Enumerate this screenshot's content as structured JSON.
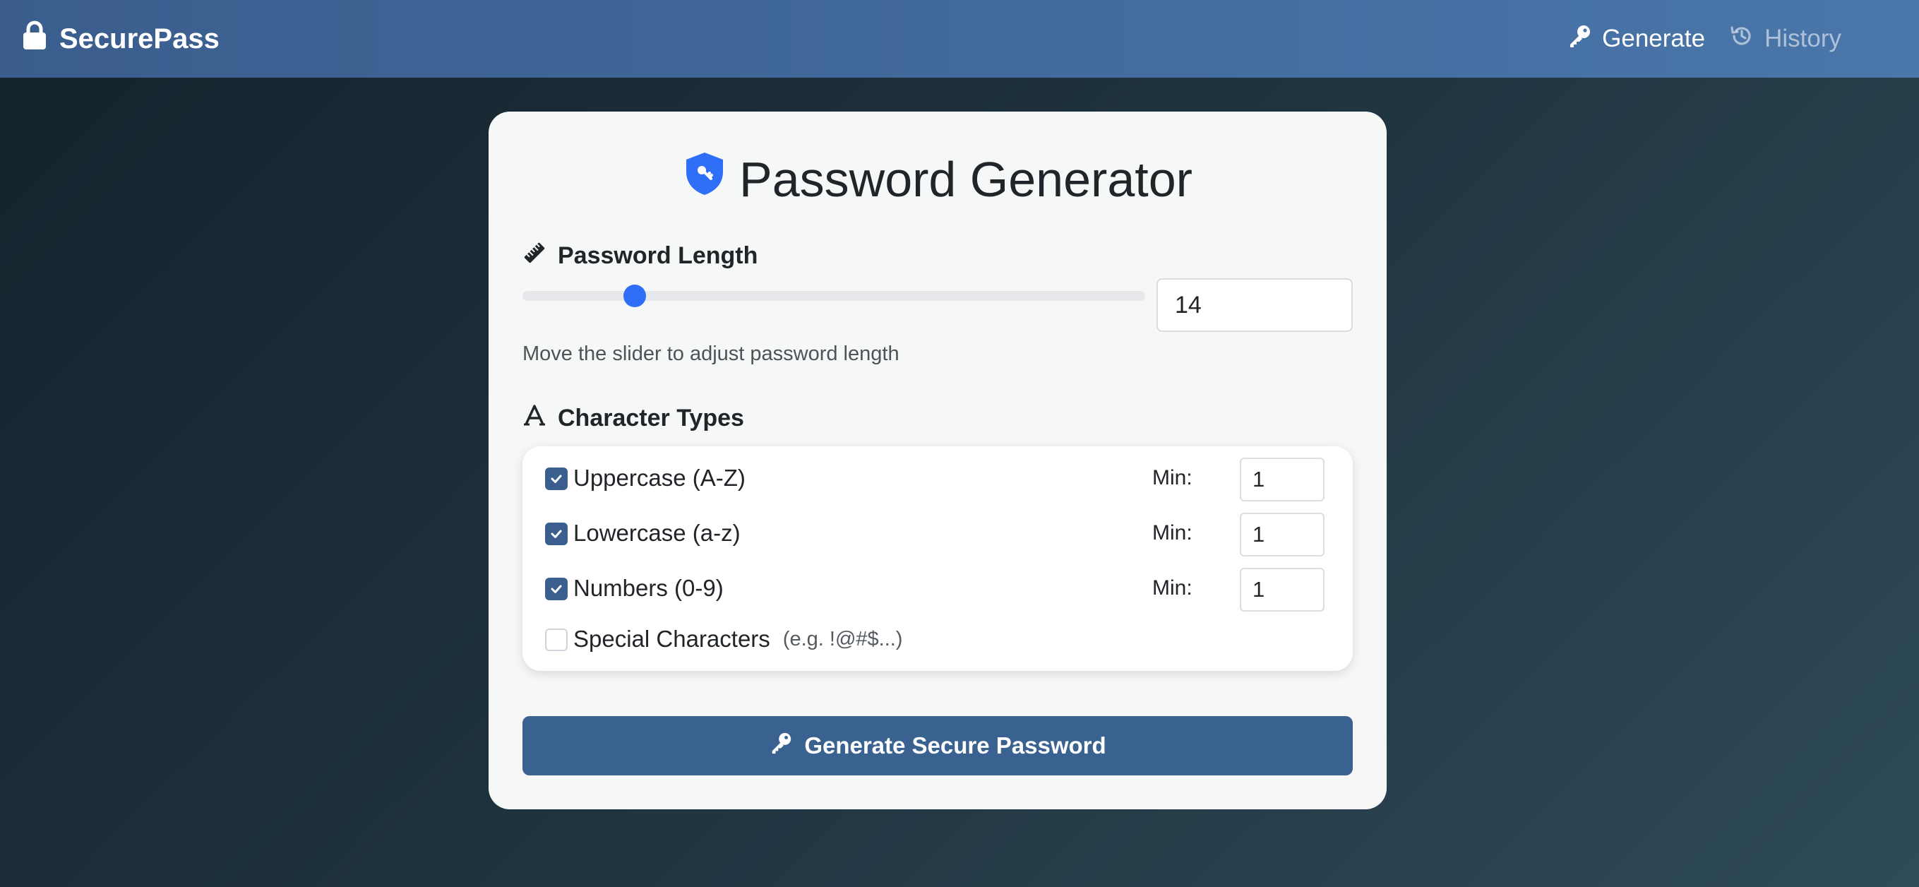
{
  "colors": {
    "navbar": "#4a76aa",
    "accent": "#2f6ef6",
    "button": "#3a6290",
    "checkbox": "#3a5f8e"
  },
  "navbar": {
    "brand": "SecurePass",
    "brand_icon": "lock-icon",
    "links": [
      {
        "label": "Generate",
        "icon": "key-icon",
        "active": true
      },
      {
        "label": "History",
        "icon": "history-icon",
        "active": false
      }
    ]
  },
  "generator": {
    "title": "Password Generator",
    "title_icon": "shield-icon",
    "length_section": {
      "label": "Password Length",
      "icon": "ruler-icon",
      "value": "14",
      "slider_fraction": 0.18,
      "help": "Move the slider to adjust password length"
    },
    "types_section": {
      "label": "Character Types",
      "icon": "font-icon",
      "min_label": "Min:",
      "types": [
        {
          "label": "Uppercase (A-Z)",
          "checked": true,
          "min": "1"
        },
        {
          "label": "Lowercase (a-z)",
          "checked": true,
          "min": "1"
        },
        {
          "label": "Numbers (0-9)",
          "checked": true,
          "min": "1"
        },
        {
          "label": "Special Characters",
          "hint": "(e.g. !@#$...)",
          "checked": false
        }
      ]
    },
    "generate_button": {
      "label": "Generate Secure Password",
      "icon": "key-icon"
    }
  }
}
